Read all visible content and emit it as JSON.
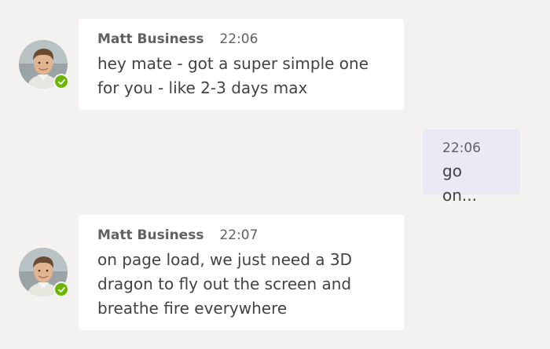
{
  "colors": {
    "background": "#f3f2f1",
    "incoming_bubble": "#ffffff",
    "outgoing_bubble": "#e9eaf6",
    "presence_available": "#6bb700"
  },
  "messages": [
    {
      "sender": "Matt Business",
      "time": "22:06",
      "lines": [
        "hey mate - got a super simple one",
        "for you - like 2-3 days max"
      ],
      "avatar_icon": "avatar-icon",
      "presence_icon": "presence-available-icon"
    },
    {
      "time": "22:06",
      "lines": [
        "go on..."
      ]
    },
    {
      "sender": "Matt Business",
      "time": "22:07",
      "lines": [
        "on page load, we just need a 3D",
        "dragon to fly out the screen and",
        "breathe fire everywhere"
      ],
      "avatar_icon": "avatar-icon",
      "presence_icon": "presence-available-icon"
    }
  ]
}
